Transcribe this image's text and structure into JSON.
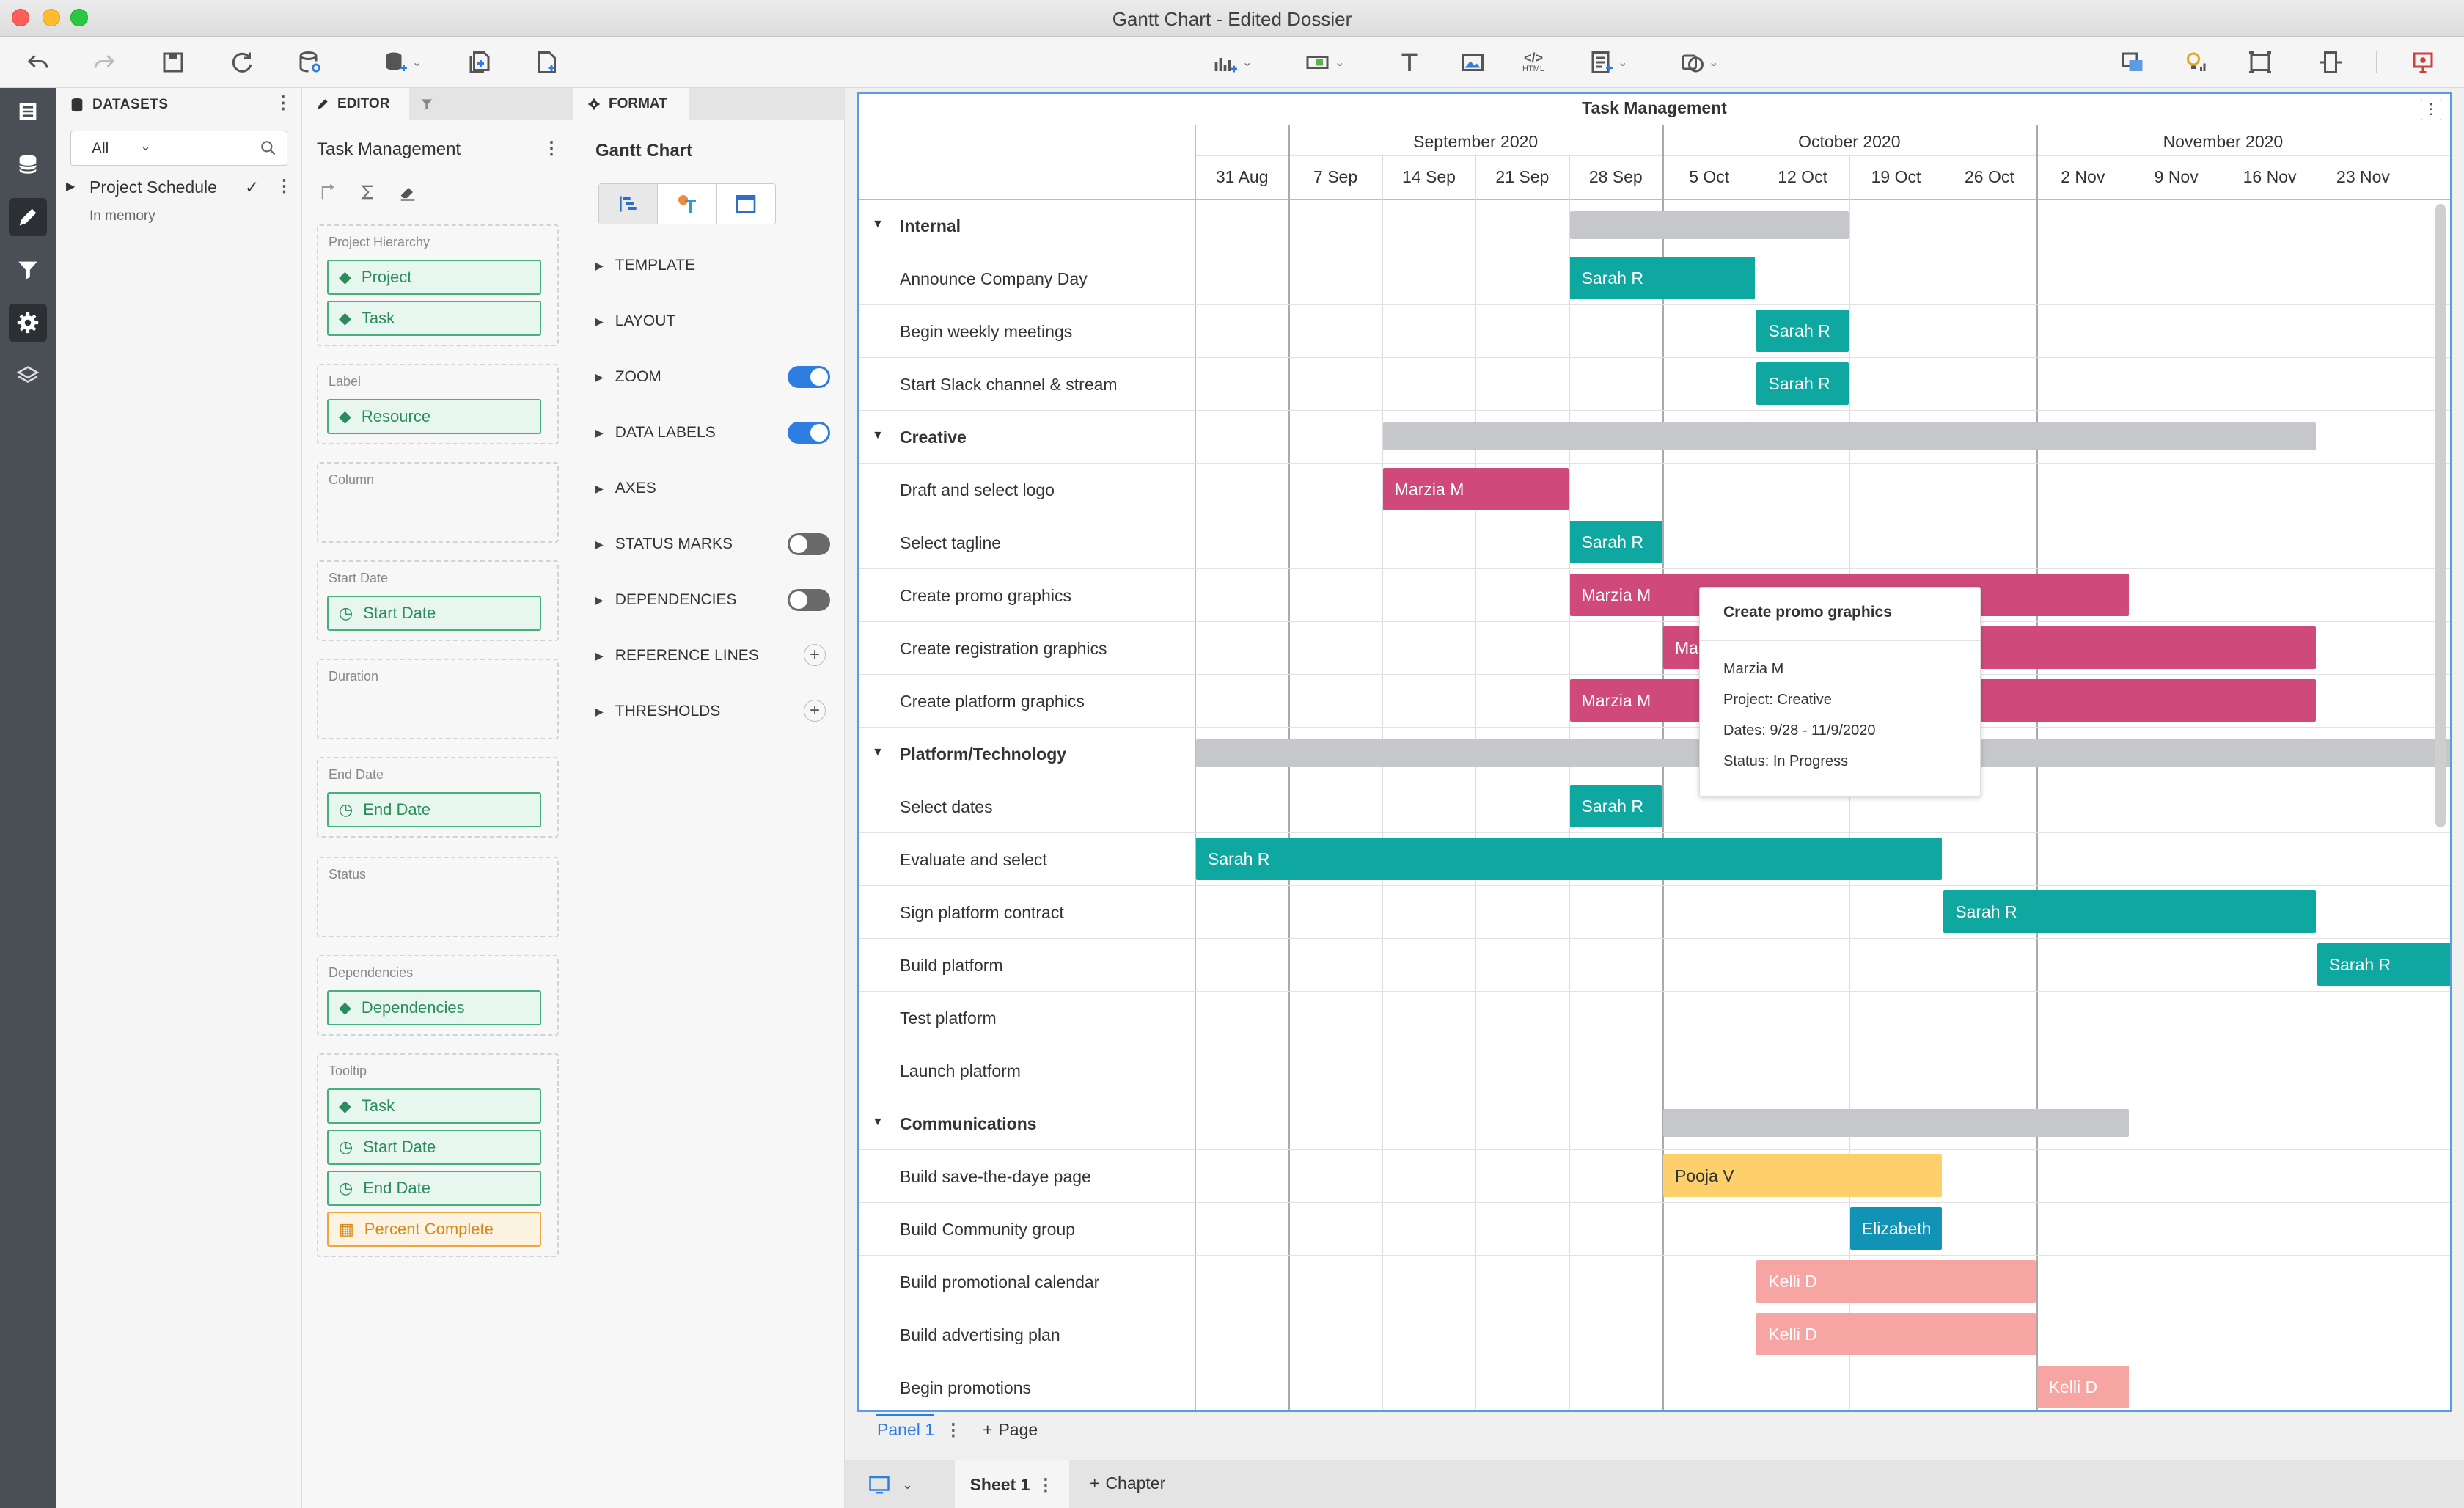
{
  "window": {
    "title": "Gantt Chart - Edited Dossier"
  },
  "toolbar": {
    "left_icons": [
      "undo-icon",
      "redo-icon",
      "save-icon",
      "refresh-icon",
      "data-source-icon",
      "add-data-icon",
      "duplicate-page-icon",
      "new-page-icon"
    ],
    "center_icons": [
      "visualization-icon",
      "filter-icon",
      "text-icon",
      "image-icon",
      "html-icon",
      "panel-stack-icon",
      "shape-icon"
    ],
    "html_label": "HTML",
    "right_icons": [
      "responsive-icon",
      "insight-icon",
      "presentation-icon",
      "full-screen-icon",
      "share-icon"
    ]
  },
  "datasets": {
    "header": "DATASETS",
    "filter_value": "All",
    "dataset_name": "Project Schedule",
    "dataset_status": "In memory"
  },
  "editor": {
    "tab_editor": "EDITOR",
    "viz_name": "Task Management",
    "zones": [
      {
        "label": "Project Hierarchy",
        "items": [
          {
            "name": "Project",
            "type": "attribute"
          },
          {
            "name": "Task",
            "type": "attribute"
          }
        ]
      },
      {
        "label": "Label",
        "items": [
          {
            "name": "Resource",
            "type": "attribute"
          }
        ]
      },
      {
        "label": "Column",
        "items": []
      },
      {
        "label": "Start Date",
        "items": [
          {
            "name": "Start Date",
            "type": "date"
          }
        ]
      },
      {
        "label": "Duration",
        "items": []
      },
      {
        "label": "End Date",
        "items": [
          {
            "name": "End Date",
            "type": "date"
          }
        ]
      },
      {
        "label": "Status",
        "items": []
      },
      {
        "label": "Dependencies",
        "items": [
          {
            "name": "Dependencies",
            "type": "attribute"
          }
        ]
      },
      {
        "label": "Tooltip",
        "items": [
          {
            "name": "Task",
            "type": "attribute"
          },
          {
            "name": "Start Date",
            "type": "date"
          },
          {
            "name": "End Date",
            "type": "date"
          },
          {
            "name": "Percent Complete",
            "type": "metric"
          }
        ]
      }
    ]
  },
  "format": {
    "tab_format": "FORMAT",
    "title": "Gantt Chart",
    "sections": [
      {
        "label": "TEMPLATE",
        "control": "none"
      },
      {
        "label": "LAYOUT",
        "control": "none"
      },
      {
        "label": "ZOOM",
        "control": "toggle",
        "on": true
      },
      {
        "label": "DATA LABELS",
        "control": "toggle",
        "on": true
      },
      {
        "label": "AXES",
        "control": "none"
      },
      {
        "label": "STATUS MARKS",
        "control": "toggle",
        "on": false
      },
      {
        "label": "DEPENDENCIES",
        "control": "toggle",
        "on": false
      },
      {
        "label": "REFERENCE LINES",
        "control": "plus"
      },
      {
        "label": "THRESHOLDS",
        "control": "plus"
      }
    ]
  },
  "gantt": {
    "title": "Task Management",
    "months": [
      "September 2020",
      "October 2020",
      "November 2020"
    ],
    "weeks": [
      "31 Aug",
      "7 Sep",
      "14 Sep",
      "21 Sep",
      "28 Sep",
      "5 Oct",
      "12 Oct",
      "19 Oct",
      "26 Oct",
      "2 Nov",
      "9 Nov",
      "16 Nov",
      "23 Nov"
    ],
    "rows": [
      {
        "label": "Internal",
        "group": true,
        "bar": {
          "start": 4,
          "end": 7,
          "summary": true
        }
      },
      {
        "label": "Announce Company Day",
        "bar": {
          "start": 4,
          "end": 6,
          "resource": "Sarah R",
          "color": "#0ea8a1"
        }
      },
      {
        "label": "Begin weekly meetings",
        "bar": {
          "start": 6,
          "end": 7,
          "resource": "Sarah R",
          "color": "#0ea8a1"
        }
      },
      {
        "label": "Start Slack channel & stream",
        "bar": {
          "start": 6,
          "end": 7,
          "resource": "Sarah R",
          "color": "#0ea8a1"
        }
      },
      {
        "label": "Creative",
        "group": true,
        "bar": {
          "start": 2,
          "end": 12,
          "summary": true
        }
      },
      {
        "label": "Draft and select logo",
        "bar": {
          "start": 2,
          "end": 4,
          "resource": "Marzia M",
          "color": "#cf4a7a"
        }
      },
      {
        "label": "Select tagline",
        "bar": {
          "start": 4,
          "end": 5,
          "resource": "Sarah R",
          "color": "#0ea8a1"
        }
      },
      {
        "label": "Create promo graphics",
        "bar": {
          "start": 4,
          "end": 10,
          "resource": "Marzia M",
          "color": "#cf4a7a"
        }
      },
      {
        "label": "Create registration graphics",
        "bar": {
          "start": 5,
          "end": 12,
          "resource": "Marzia M",
          "color": "#cf4a7a"
        }
      },
      {
        "label": "Create platform graphics",
        "bar": {
          "start": 4,
          "end": 12,
          "resource": "Marzia M",
          "color": "#cf4a7a"
        }
      },
      {
        "label": "Platform/Technology",
        "group": true,
        "bar": {
          "start": 0,
          "end": 13.5,
          "summary": true
        }
      },
      {
        "label": "Select dates",
        "bar": {
          "start": 4,
          "end": 5,
          "resource": "Sarah R",
          "color": "#0ea8a1"
        }
      },
      {
        "label": "Evaluate and select",
        "bar": {
          "start": 0,
          "end": 8,
          "resource": "Sarah R",
          "color": "#0ea8a1"
        }
      },
      {
        "label": "Sign platform contract",
        "bar": {
          "start": 8,
          "end": 12,
          "resource": "Sarah R",
          "color": "#0ea8a1"
        }
      },
      {
        "label": "Build platform",
        "bar": {
          "start": 12,
          "end": 13.5,
          "resource": "Sarah R",
          "color": "#0ea8a1"
        }
      },
      {
        "label": "Test platform"
      },
      {
        "label": "Launch platform"
      },
      {
        "label": "Communications",
        "group": true,
        "bar": {
          "start": 5,
          "end": 10,
          "summary": true
        }
      },
      {
        "label": "Build save-the-daye page",
        "bar": {
          "start": 5,
          "end": 8,
          "resource": "Pooja V",
          "color": "#fdd06b",
          "dark_text": true
        }
      },
      {
        "label": "Build Community group",
        "bar": {
          "start": 7,
          "end": 8,
          "resource": "Elizabeth",
          "color": "#1193b5"
        }
      },
      {
        "label": "Build promotional calendar",
        "bar": {
          "start": 6,
          "end": 9,
          "resource": "Kelli D",
          "color": "#f6a5a3"
        }
      },
      {
        "label": "Build advertising plan",
        "bar": {
          "start": 6,
          "end": 9,
          "resource": "Kelli D",
          "color": "#f6a5a3"
        }
      },
      {
        "label": "Begin promotions",
        "bar": {
          "start": 9,
          "end": 10,
          "resource": "Kelli D",
          "color": "#f6a5a3"
        }
      }
    ],
    "tooltip": {
      "title": "Create promo graphics",
      "resource": "Marzia M",
      "project": "Project: Creative",
      "dates": "Dates: 9/28 - 11/9/2020",
      "status": "Status: In Progress"
    }
  },
  "bottom": {
    "panel_tab": "Panel 1",
    "add_page": "Page",
    "sheet_tab": "Sheet 1",
    "add_chapter": "Chapter"
  }
}
